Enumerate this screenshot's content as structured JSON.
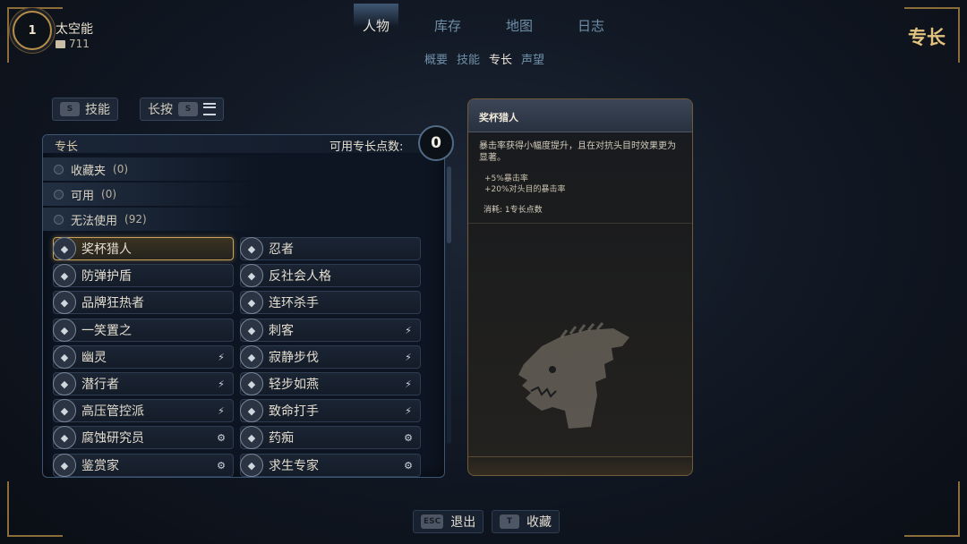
{
  "player": {
    "level": "1",
    "name": "太空能",
    "currency": "711"
  },
  "tabs": [
    {
      "label": "人物",
      "active": true
    },
    {
      "label": "库存",
      "active": false
    },
    {
      "label": "地图",
      "active": false
    },
    {
      "label": "日志",
      "active": false
    }
  ],
  "subtabs": [
    {
      "label": "概要",
      "active": false
    },
    {
      "label": "技能",
      "active": false
    },
    {
      "label": "专长",
      "active": true
    },
    {
      "label": "声望",
      "active": false
    }
  ],
  "page_label": "专长",
  "filters": {
    "skills": {
      "key": "S",
      "label": "技能"
    },
    "hold": {
      "label": "长按",
      "key": "S"
    }
  },
  "panel": {
    "title": "专长",
    "points_label": "可用专长点数:",
    "points_value": "0",
    "categories": [
      {
        "label": "收藏夹",
        "count": "(0)"
      },
      {
        "label": "可用",
        "count": "(0)"
      },
      {
        "label": "无法使用",
        "count": "(92)"
      }
    ],
    "perks_left": [
      {
        "label": "奖杯猎人",
        "icon": "trophy-icon",
        "tag": "",
        "selected": true
      },
      {
        "label": "防弹护盾",
        "icon": "shield-icon",
        "tag": ""
      },
      {
        "label": "品牌狂热者",
        "icon": "brand-icon",
        "tag": ""
      },
      {
        "label": "一笑置之",
        "icon": "laugh-icon",
        "tag": ""
      },
      {
        "label": "幽灵",
        "icon": "ghost-icon",
        "tag": "sneak-icon"
      },
      {
        "label": "潜行者",
        "icon": "prowler-icon",
        "tag": "sneak-icon"
      },
      {
        "label": "高压管控派",
        "icon": "pressure-icon",
        "tag": "sneak-icon"
      },
      {
        "label": "腐蚀研究员",
        "icon": "corrosion-icon",
        "tag": "gear-icon"
      },
      {
        "label": "鉴赏家",
        "icon": "connoisseur-icon",
        "tag": "gear-icon"
      }
    ],
    "perks_right": [
      {
        "label": "忍者",
        "icon": "ninja-icon",
        "tag": ""
      },
      {
        "label": "反社会人格",
        "icon": "sociopath-icon",
        "tag": ""
      },
      {
        "label": "连环杀手",
        "icon": "serial-killer-icon",
        "tag": ""
      },
      {
        "label": "刺客",
        "icon": "assassin-icon",
        "tag": "sneak-icon"
      },
      {
        "label": "寂静步伐",
        "icon": "silent-step-icon",
        "tag": "sneak-icon"
      },
      {
        "label": "轻步如燕",
        "icon": "light-step-icon",
        "tag": "sneak-icon"
      },
      {
        "label": "致命打手",
        "icon": "deadly-striker-icon",
        "tag": "sneak-icon"
      },
      {
        "label": "药痴",
        "icon": "pill-icon",
        "tag": "gear-icon"
      },
      {
        "label": "求生专家",
        "icon": "survival-icon",
        "tag": "gear-icon"
      }
    ]
  },
  "detail": {
    "title": "奖杯猎人",
    "description": "暴击率获得小幅度提升，且在对抗头目时效果更为显著。",
    "bonus_1": "+5%暴击率",
    "bonus_2": "+20%对头目的暴击率",
    "cost": "消耗:  1专长点数"
  },
  "actions": {
    "exit": {
      "key": "ESC",
      "label": "退出"
    },
    "favorite": {
      "key": "T",
      "label": "收藏"
    }
  },
  "colors": {
    "accent_gold": "#c9a25b",
    "tab_inactive": "#6f8fa8",
    "panel_border": "#3b5575"
  }
}
